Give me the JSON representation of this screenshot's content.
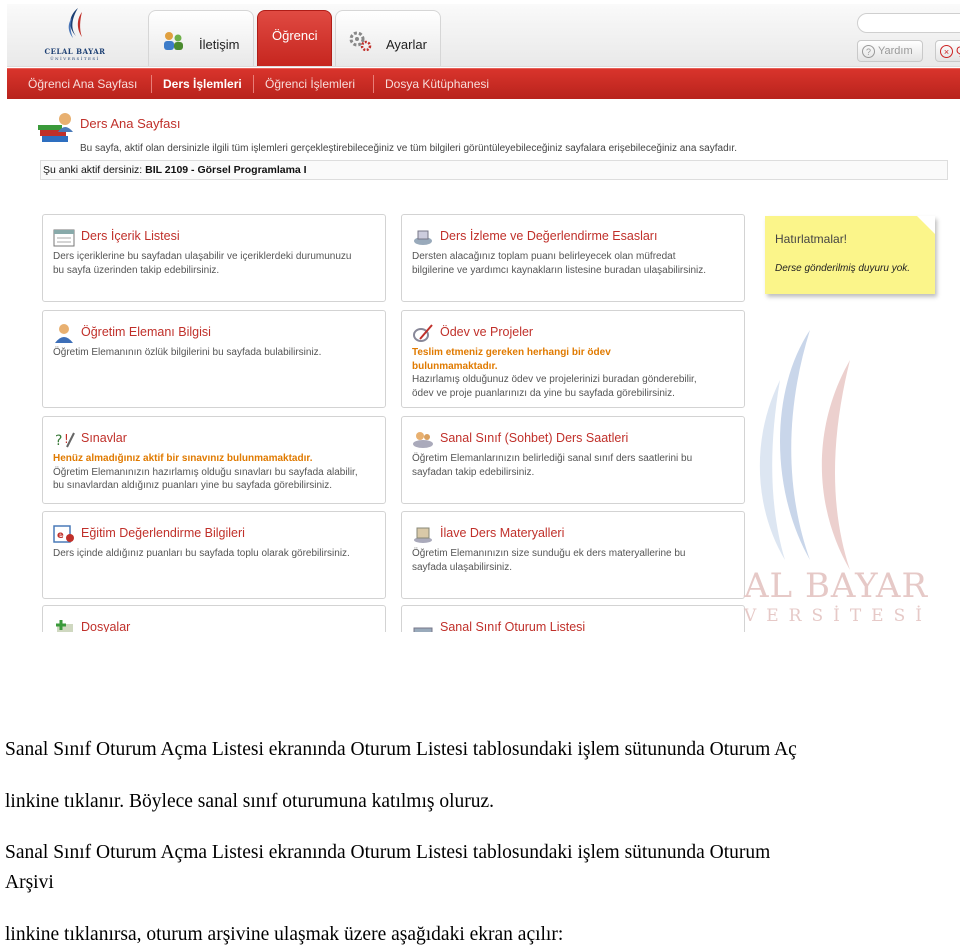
{
  "logo": {
    "name_line1": "CELAL BAYAR",
    "name_line2": "ÜNİVERSİTESİ"
  },
  "tabs": [
    {
      "label": "İletişim",
      "icon": "contact-icon"
    },
    {
      "label": "Öğrenci",
      "icon": ""
    },
    {
      "label": "Ayarlar",
      "icon": "gears-icon"
    }
  ],
  "top_buttons": {
    "help": "Yardım",
    "exit": "Ç"
  },
  "nav": [
    "Öğrenci Ana Sayfası",
    "Ders İşlemleri",
    "Öğrenci İşlemleri",
    "Dosya Kütüphanesi"
  ],
  "nav_active": "Ders İşlemleri",
  "page": {
    "title": "Ders Ana Sayfası",
    "description": "Bu sayfa, aktif olan dersinizle ilgili tüm işlemleri gerçekleştirebileceğiniz ve tüm bilgileri görüntüleyebileceğiniz sayfalara erişebileceğiniz ana sayfadır.",
    "active_course_label": "Şu anki aktif dersiniz:",
    "active_course": "BIL 2109 - Görsel Programlama I"
  },
  "cards": [
    {
      "title": "Ders İçerik Listesi",
      "icon": "calendar-list-icon",
      "warning": "",
      "body_lines": [
        "Ders içeriklerine bu sayfadan ulaşabilir ve içeriklerdeki durumunuzu",
        "bu sayfa üzerinden takip edebilirsiniz."
      ]
    },
    {
      "title": "Ders İzleme ve Değerlendirme Esasları",
      "icon": "evaluation-icon",
      "warning": "",
      "body_lines": [
        "Dersten alacağınız toplam puanı belirleyecek olan müfredat",
        "bilgilerine ve yardımcı kaynakların listesine buradan ulaşabilirsiniz."
      ]
    },
    {
      "title": "Öğretim Elemanı Bilgisi",
      "icon": "instructor-icon",
      "warning": "",
      "body_lines": [
        "Öğretim Elemanının özlük bilgilerini bu sayfada bulabilirsiniz."
      ]
    },
    {
      "title": "Ödev ve Projeler",
      "icon": "assignment-icon",
      "warning_lines": [
        "Teslim etmeniz gereken herhangi bir ödev",
        "bulunmamaktadır."
      ],
      "body_lines": [
        "Hazırlamış olduğunuz ödev ve projelerinizi buradan gönderebilir,",
        "ödev ve proje puanlarınızı da yine bu sayfada görebilirsiniz."
      ]
    },
    {
      "title": "Sınavlar",
      "icon": "exam-icon",
      "warning_lines": [
        "Henüz almadığınız aktif bir sınavınız bulunmamaktadır."
      ],
      "body_lines": [
        "Öğretim Elemanınızın hazırlamış olduğu sınavları bu sayfada alabilir,",
        "bu sınavlardan aldığınız puanları yine bu sayfada görebilirsiniz."
      ]
    },
    {
      "title": "Sanal Sınıf (Sohbet) Ders Saatleri",
      "icon": "virtual-class-icon",
      "warning": "",
      "body_lines": [
        "Öğretim Elemanlarınızın belirlediği sanal sınıf ders saatlerini bu",
        "sayfadan takip edebilirsiniz."
      ]
    },
    {
      "title": "Eğitim Değerlendirme Bilgileri",
      "icon": "grades-icon",
      "warning": "",
      "body_lines": [
        "Ders içinde aldığınız puanları bu sayfada toplu olarak görebilirsiniz."
      ]
    },
    {
      "title": "İlave Ders Materyalleri",
      "icon": "materials-icon",
      "warning": "",
      "body_lines": [
        "Öğretim Elemanınızın size sunduğu ek ders materyallerine bu",
        "sayfada ulaşabilirsiniz."
      ]
    },
    {
      "title": "Dosyalar",
      "icon": "files-icon",
      "warning": "",
      "body_lines": []
    },
    {
      "title": "Sanal Sınıf Oturum Listesi",
      "icon": "session-list-icon",
      "warning": "",
      "body_lines": []
    }
  ],
  "reminder": {
    "title": "Hatırlatmalar!",
    "text": "Derse gönderilmiş duyuru yok."
  },
  "watermark": {
    "line1": "AL BAYAR",
    "line2": "VERSİTESİ"
  },
  "document": {
    "p1_line1": "Sanal Sınıf Oturum Açma Listesi ekranında Oturum Listesi tablosundaki işlem sütununda Oturum Aç",
    "p1_line2": "linkine tıklanır. Böylece sanal sınıf oturumuna katılmış oluruz.",
    "p2_line1": "Sanal Sınıf Oturum Açma Listesi ekranında Oturum Listesi tablosundaki işlem sütununda Oturum",
    "p2_line2": "Arşivi",
    "p2_line3": "linkine tıklanırsa, oturum arşivine ulaşmak üzere aşağıdaki ekran açılır:"
  }
}
